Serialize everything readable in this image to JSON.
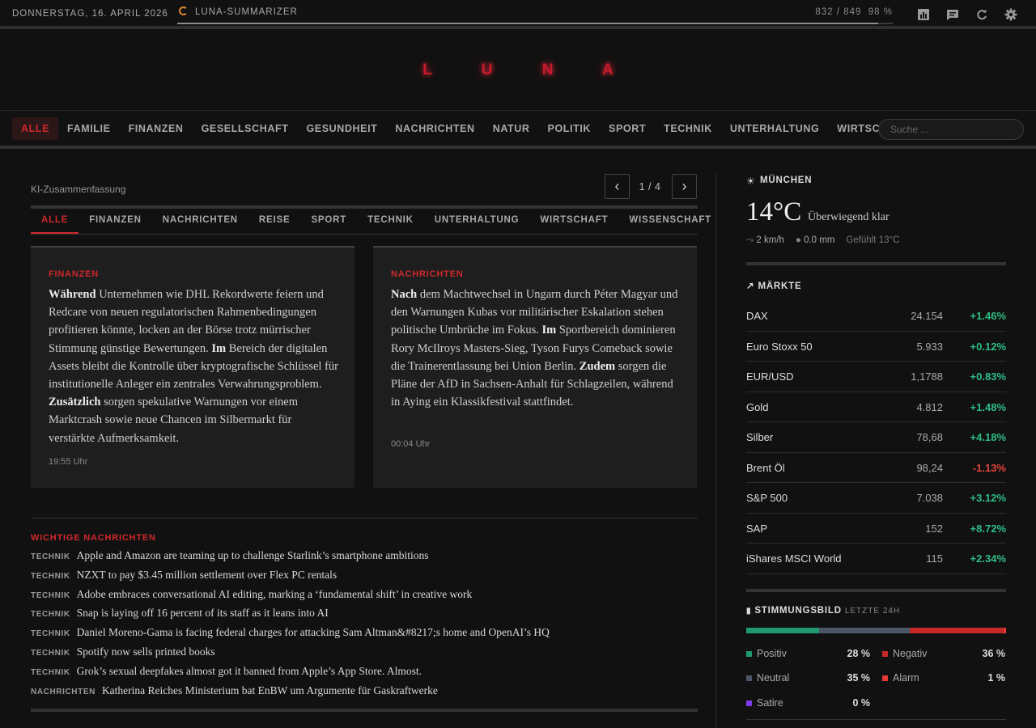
{
  "topbar": {
    "date": "DONNERSTAG, 16. APRIL 2026",
    "summarizer_label": "LUNA-SUMMARIZER",
    "progress_count": "832 / 849",
    "progress_percent": "98 %",
    "progress_value": 0.98,
    "icons": [
      "chart-icon",
      "chat-icon",
      "refresh-icon",
      "settings-icon"
    ]
  },
  "logo": "L U N A",
  "nav": {
    "items": [
      "ALLE",
      "FAMILIE",
      "FINANZEN",
      "GESELLSCHAFT",
      "GESUNDHEIT",
      "NACHRICHTEN",
      "NATUR",
      "POLITIK",
      "SPORT",
      "TECHNIK",
      "UNTERHALTUNG",
      "WIRTSCHAFT"
    ],
    "active": "ALLE",
    "search_placeholder": "Suche ..."
  },
  "summary": {
    "label": "KI-Zusammenfassung",
    "page": "1 / 4",
    "prev": "‹",
    "next": "›",
    "tabs": [
      "ALLE",
      "FINANZEN",
      "NACHRICHTEN",
      "REISE",
      "SPORT",
      "TECHNIK",
      "UNTERHALTUNG",
      "WIRTSCHAFT",
      "WISSENSCHAFT"
    ],
    "active_tab": "ALLE",
    "cards": [
      {
        "category": "FINANZEN",
        "segments": [
          {
            "b": "Während",
            "t": " Unternehmen wie DHL Rekordwerte feiern und Redcare von neuen regulatorischen Rahmenbedingungen profitieren könnte, locken an der Börse trotz mürrischer Stimmung günstige Bewertungen. "
          },
          {
            "b": "Im",
            "t": " Bereich der digitalen Assets bleibt die Kontrolle über kryptografische Schlüssel für institutionelle Anleger ein zentrales Verwahrungsproblem. "
          },
          {
            "b": "Zusätzlich",
            "t": " sorgen spekulative Warnungen vor einem Marktcrash sowie neue Chancen im Silbermarkt für verstärkte Aufmerksamkeit."
          }
        ],
        "time": "19:55 Uhr"
      },
      {
        "category": "NACHRICHTEN",
        "segments": [
          {
            "b": "Nach",
            "t": " dem Machtwechsel in Ungarn durch Péter Magyar und den Warnungen Kubas vor militärischer Eskalation stehen politische Umbrüche im Fokus. "
          },
          {
            "b": "Im",
            "t": " Sportbereich dominieren Rory McIlroys Masters-Sieg, Tyson Furys Comeback sowie die Trainerentlassung bei Union Berlin. "
          },
          {
            "b": "Zudem",
            "t": " sorgen die Pläne der AfD in Sachsen-Anhalt für Schlagzeilen, während in Aying ein Klassikfestival stattfindet."
          }
        ],
        "time": "00:04 Uhr"
      }
    ]
  },
  "important": {
    "title": "WICHTIGE NACHRICHTEN",
    "items": [
      {
        "tag": "TECHNIK",
        "title": "Apple and Amazon are teaming up to challenge Starlink’s smartphone ambitions"
      },
      {
        "tag": "TECHNIK",
        "title": "NZXT to pay $3.45 million settlement over Flex PC rentals"
      },
      {
        "tag": "TECHNIK",
        "title": "Adobe embraces conversational AI editing, marking a ‘fundamental shift’ in creative work"
      },
      {
        "tag": "TECHNIK",
        "title": "Snap is laying off 16 percent of its staff as it leans into AI"
      },
      {
        "tag": "TECHNIK",
        "title": "Daniel Moreno-Gama is facing federal charges for attacking Sam Altman&#8217;s home and OpenAI’s HQ"
      },
      {
        "tag": "TECHNIK",
        "title": "Spotify now sells printed books"
      },
      {
        "tag": "TECHNIK",
        "title": "Grok’s sexual deepfakes almost got it banned from Apple’s App Store. Almost."
      },
      {
        "tag": "NACHRICHTEN",
        "title": "Katherina Reiches Ministerium bat EnBW um Argumente für Gaskraftwerke"
      }
    ]
  },
  "weather": {
    "icon": "sun-icon",
    "city": "MÜNCHEN",
    "temp": "14°C",
    "desc": "Überwiegend klar",
    "wind": "2 km/h",
    "rain": "0.0 mm",
    "feels": "Gefühlt 13°C"
  },
  "markets": {
    "title": "MÄRKTE",
    "rows": [
      {
        "name": "DAX",
        "value": "24.154",
        "change": "+1.46%"
      },
      {
        "name": "Euro Stoxx 50",
        "value": "5.933",
        "change": "+0.12%"
      },
      {
        "name": "EUR/USD",
        "value": "1,1788",
        "change": "+0.83%"
      },
      {
        "name": "Gold",
        "value": "4.812",
        "change": "+1.48%"
      },
      {
        "name": "Silber",
        "value": "78,68",
        "change": "+4.18%"
      },
      {
        "name": "Brent Öl",
        "value": "98,24",
        "change": "-1.13%"
      },
      {
        "name": "S&P 500",
        "value": "7.038",
        "change": "+3.12%"
      },
      {
        "name": "SAP",
        "value": "152",
        "change": "+8.72%"
      },
      {
        "name": "iShares MSCI World",
        "value": "115",
        "change": "+2.34%"
      }
    ]
  },
  "sentiment": {
    "title": "STIMMUNGSBILD",
    "subtitle": "LETZTE 24H",
    "items": [
      {
        "name": "Positiv",
        "pct": "28 %",
        "value": 28,
        "color": "#1f9a6f"
      },
      {
        "name": "Neutral",
        "pct": "35 %",
        "value": 35,
        "color": "#4a5568"
      },
      {
        "name": "Negativ",
        "pct": "36 %",
        "value": 36,
        "color": "#c62828"
      },
      {
        "name": "Alarm",
        "pct": "1 %",
        "value": 1,
        "color": "#e53935"
      },
      {
        "name": "Satire",
        "pct": "0 %",
        "value": 0,
        "color": "#7c3aed"
      }
    ]
  },
  "colors": {
    "accent": "#d0282c",
    "positive": "#2ebd85",
    "negative": "#e0433c",
    "summarizer_icon": "#d9822b"
  }
}
